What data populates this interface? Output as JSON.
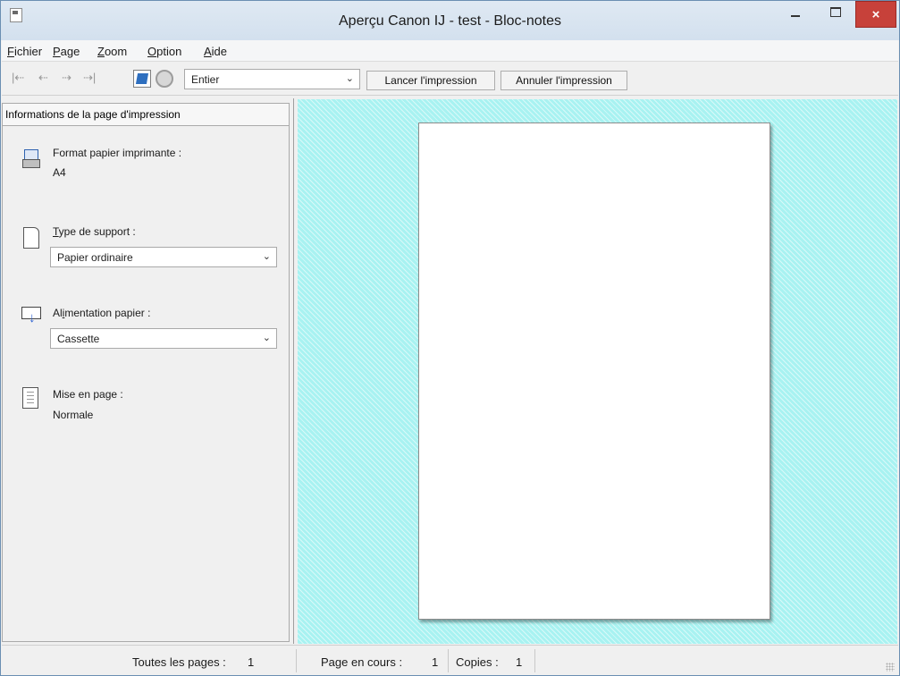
{
  "window": {
    "title": "Aperçu Canon IJ - test - Bloc-notes",
    "close_glyph": "×"
  },
  "menu": {
    "items": [
      {
        "accel": "F",
        "rest": "ichier"
      },
      {
        "accel": "P",
        "rest": "age"
      },
      {
        "accel": "Z",
        "rest": "oom"
      },
      {
        "accel": "O",
        "rest": "ption"
      },
      {
        "accel": "A",
        "rest": "ide"
      }
    ]
  },
  "toolbar": {
    "nav_first": "|⇠",
    "nav_prev": "⇠",
    "nav_next": "⇢",
    "nav_last": "⇢|",
    "zoom_value": "Entier",
    "print_button": "Lancer l'impression",
    "cancel_button": "Annuler l'impression",
    "dropdown_glyph": "⌄"
  },
  "panel": {
    "header": "Informations de la page d'impression",
    "paper_size": {
      "label": "Format papier imprimante :",
      "value": "A4"
    },
    "media_type": {
      "accel": "T",
      "rest": "ype de support :",
      "value": "Papier ordinaire"
    },
    "paper_source": {
      "label_start": "Al",
      "accel": "i",
      "label_end": "mentation papier :",
      "value": "Cassette"
    },
    "page_layout": {
      "label": "Mise en page :",
      "value": "Normale"
    }
  },
  "status": {
    "all_pages_label": "Toutes les pages :",
    "all_pages_value": "1",
    "current_page_label": "Page en cours :",
    "current_page_value": "1",
    "copies_label": "Copies :",
    "copies_value": "1"
  },
  "colors": {
    "preview_background": "#a8f2f1",
    "close_button": "#c7413a",
    "titlebar": "#d3e0ee"
  }
}
